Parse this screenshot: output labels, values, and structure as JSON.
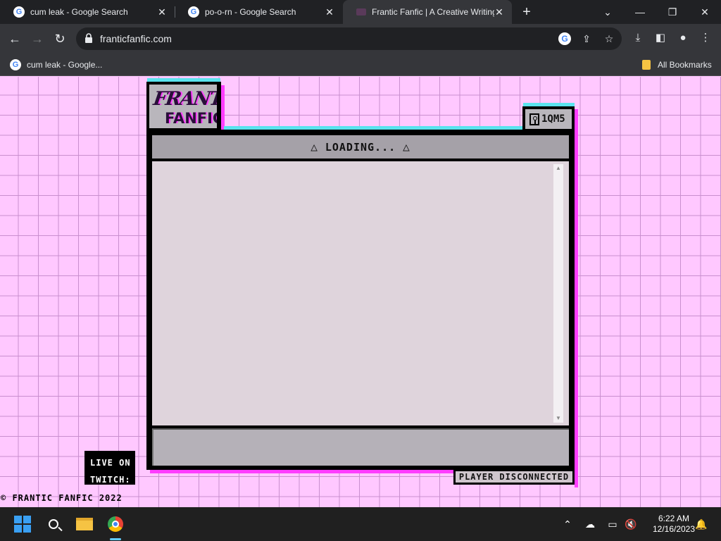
{
  "browser": {
    "tabs": [
      {
        "title": "cum leak - Google Search",
        "favicon": "google-icon",
        "active": false
      },
      {
        "title": "po-o-rn - Google Search",
        "favicon": "google-icon",
        "active": false
      },
      {
        "title": "Frantic Fanfic | A Creative Writing",
        "favicon": "frantic-fanfic-icon",
        "active": true
      }
    ],
    "new_tab_label": "+",
    "url": "franticfanfic.com",
    "bookmarks": [
      {
        "label": "cum leak - Google...",
        "icon": "google-icon"
      }
    ],
    "all_bookmarks_label": "All Bookmarks"
  },
  "site": {
    "logo_line1": "FRANTIC",
    "logo_line2": "FANFIC",
    "room_code": "1QM5",
    "status": "LOADING...",
    "player_status": "PLAYER DISCONNECTED",
    "twitch_line1": "LIVE ON",
    "twitch_line2": "TWITCH:",
    "copyright": "© FRANTIC FANFIC 2022",
    "colors": {
      "background": "#ffc8ff",
      "grid": "#c98fcf",
      "accent_cyan": "#5ae3ee",
      "accent_pink": "#ff3dff",
      "panel": "#b9b6bc"
    }
  },
  "taskbar": {
    "time": "6:22 AM",
    "date": "12/16/2023"
  }
}
